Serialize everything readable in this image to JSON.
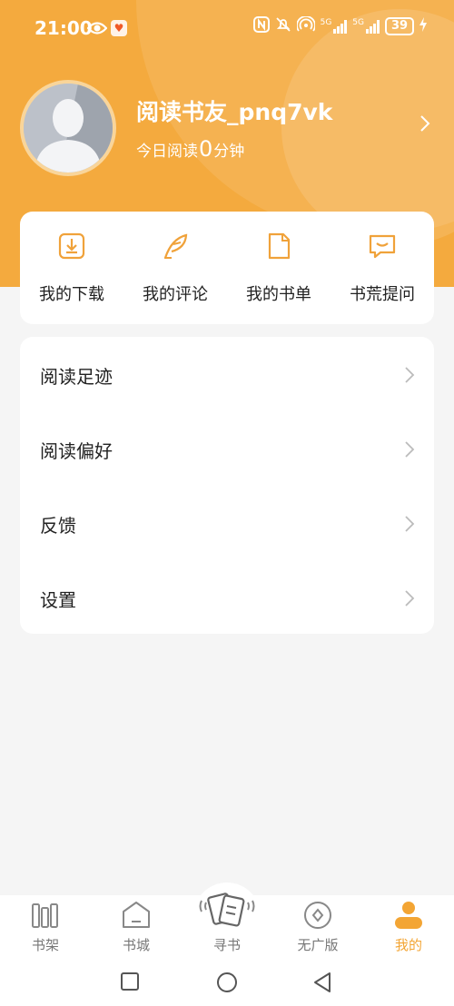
{
  "status_bar": {
    "time": "21:00",
    "signal_1": "5G",
    "signal_2": "5G",
    "battery": "39"
  },
  "profile": {
    "username": "阅读书友_pnq7vk",
    "reading_prefix": "今日阅读",
    "reading_minutes": "0",
    "reading_suffix": "分钟"
  },
  "quick_actions": [
    {
      "label": "我的下载",
      "icon": "download-icon"
    },
    {
      "label": "我的评论",
      "icon": "feather-icon"
    },
    {
      "label": "我的书单",
      "icon": "document-icon"
    },
    {
      "label": "书荒提问",
      "icon": "message-icon"
    }
  ],
  "menu": [
    {
      "label": "阅读足迹"
    },
    {
      "label": "阅读偏好"
    },
    {
      "label": "反馈"
    },
    {
      "label": "设置"
    }
  ],
  "tabs": [
    {
      "label": "书架",
      "icon": "bookshelf-icon"
    },
    {
      "label": "书城",
      "icon": "home-icon"
    },
    {
      "label": "寻书",
      "icon": "find-book-icon"
    },
    {
      "label": "无广版",
      "icon": "no-ads-icon"
    },
    {
      "label": "我的",
      "icon": "person-icon",
      "active": true
    }
  ],
  "colors": {
    "accent": "#f4aa3e",
    "active_tab": "#f3a534",
    "background": "#f5f5f5"
  }
}
